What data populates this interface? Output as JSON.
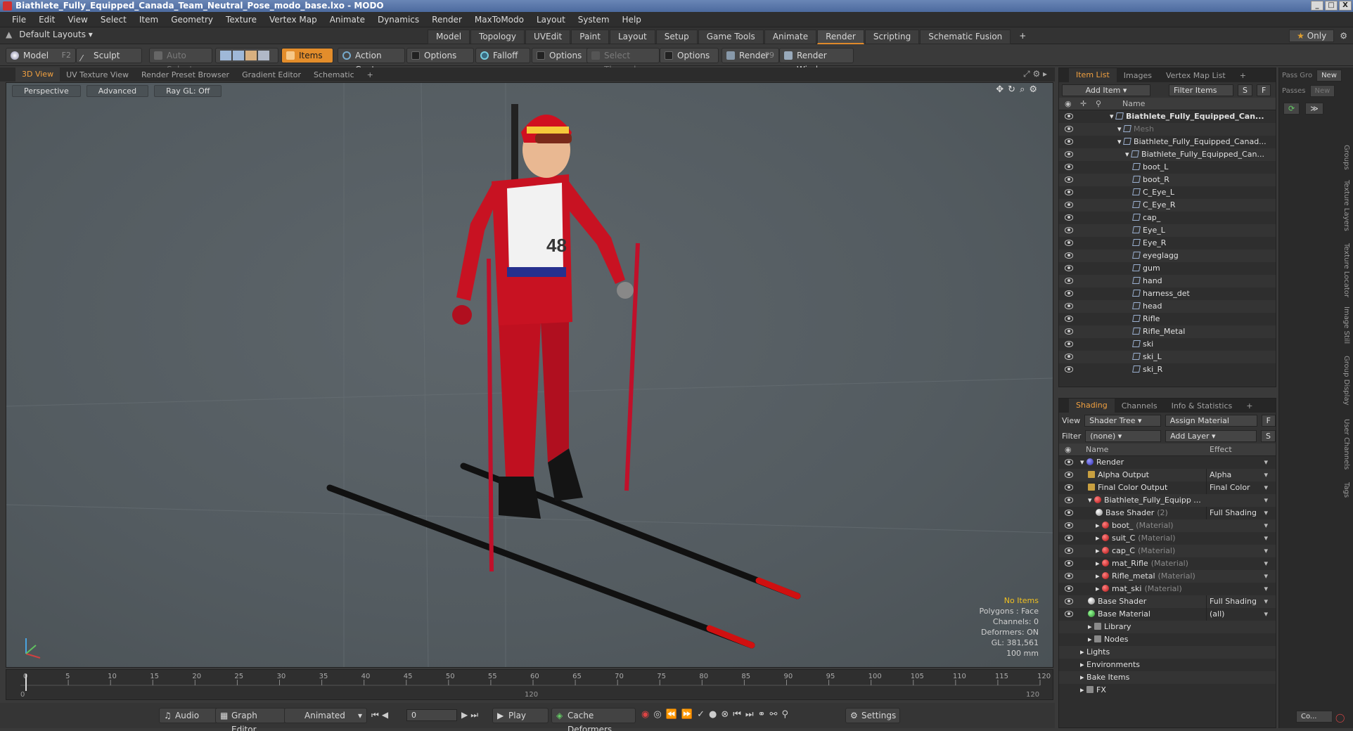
{
  "window": {
    "title": "Biathlete_Fully_Equipped_Canada_Team_Neutral_Pose_modo_base.lxo - MODO",
    "buttons": [
      "_",
      "□",
      "X"
    ]
  },
  "menu": [
    "File",
    "Edit",
    "View",
    "Select",
    "Item",
    "Geometry",
    "Texture",
    "Vertex Map",
    "Animate",
    "Dynamics",
    "Render",
    "MaxToModo",
    "Layout",
    "System",
    "Help"
  ],
  "layoutbar": {
    "layout_select": "Default Layouts",
    "tabs": [
      "Model",
      "Topology",
      "UVEdit",
      "Paint",
      "Layout",
      "Setup",
      "Game Tools",
      "Animate",
      "Render",
      "Scripting",
      "Schematic Fusion"
    ],
    "active_tab": "Render",
    "only_label": "Only"
  },
  "toolbar": {
    "model": "Model",
    "model_key": "F2",
    "sculpt": "Sculpt",
    "auto_select": "Auto Select",
    "items": "Items",
    "action_center": "Action Center",
    "options1": "Options",
    "falloff": "Falloff",
    "options2": "Options",
    "select_through": "Select Through",
    "options3": "Options",
    "render": "Render",
    "render_key": "F9",
    "render_window": "Render Window"
  },
  "viewport_tabs": [
    "3D View",
    "UV Texture View",
    "Render Preset Browser",
    "Gradient Editor",
    "Schematic",
    "+"
  ],
  "viewport": {
    "perspective": "Perspective",
    "advanced": "Advanced",
    "raygl": "Ray GL: Off",
    "info": {
      "no_items": "No Items",
      "polygons": "Polygons : Face",
      "channels": "Channels: 0",
      "deformers": "Deformers: ON",
      "gl": "GL: 381,561",
      "scale": "100 mm"
    },
    "bib_number": "48"
  },
  "timeline": {
    "ticks": [
      "0",
      "5",
      "10",
      "15",
      "20",
      "25",
      "30",
      "35",
      "40",
      "45",
      "50",
      "55",
      "60",
      "65",
      "70",
      "75",
      "80",
      "85",
      "90",
      "95",
      "100",
      "105",
      "110",
      "115",
      "120"
    ],
    "start": "0",
    "mid": "120",
    "end": "120"
  },
  "bottombar": {
    "audio": "Audio",
    "graph_editor": "Graph Editor",
    "animated": "Animated",
    "frame": "0",
    "play": "Play",
    "cache_deformers": "Cache Deformers",
    "settings": "Settings"
  },
  "itemlist": {
    "tabs": [
      "Item List",
      "Images",
      "Vertex Map List",
      "+"
    ],
    "add_item": "Add Item",
    "filter_items": "Filter Items",
    "s": "S",
    "f": "F",
    "col_name": "Name",
    "rows": [
      {
        "name": "Biathlete_Fully_Equipped_Can...",
        "indent": 0,
        "bold": true
      },
      {
        "name": "Mesh",
        "indent": 1,
        "dim": true
      },
      {
        "name": "Biathlete_Fully_Equipped_Canad...",
        "indent": 1
      },
      {
        "name": "Biathlete_Fully_Equipped_Can...",
        "indent": 2
      },
      {
        "name": "boot_L",
        "indent": 3
      },
      {
        "name": "boot_R",
        "indent": 3
      },
      {
        "name": "C_Eye_L",
        "indent": 3
      },
      {
        "name": "C_Eye_R",
        "indent": 3
      },
      {
        "name": "cap_",
        "indent": 3
      },
      {
        "name": "Eye_L",
        "indent": 3
      },
      {
        "name": "Eye_R",
        "indent": 3
      },
      {
        "name": "eyeglagg",
        "indent": 3
      },
      {
        "name": "gum",
        "indent": 3
      },
      {
        "name": "hand",
        "indent": 3
      },
      {
        "name": "harness_det",
        "indent": 3
      },
      {
        "name": "head",
        "indent": 3
      },
      {
        "name": "Rifle",
        "indent": 3
      },
      {
        "name": "Rifle_Metal",
        "indent": 3
      },
      {
        "name": "ski",
        "indent": 3
      },
      {
        "name": "ski_L",
        "indent": 3
      },
      {
        "name": "ski_R",
        "indent": 3
      }
    ]
  },
  "shading": {
    "tabs": [
      "Shading",
      "Channels",
      "Info & Statistics",
      "+"
    ],
    "view_label": "View",
    "view_value": "Shader Tree",
    "assign_material": "Assign Material",
    "filter_label": "Filter",
    "filter_value": "(none)",
    "add_layer": "Add Layer",
    "f": "F",
    "s": "S",
    "col_name": "Name",
    "col_effect": "Effect",
    "rows": [
      {
        "name": "Render",
        "sub": "",
        "effect": "",
        "indent": 0,
        "icon": "blue"
      },
      {
        "name": "Alpha Output",
        "sub": "",
        "effect": "Alpha",
        "indent": 1,
        "icon": "out"
      },
      {
        "name": "Final Color Output",
        "sub": "",
        "effect": "Final Color",
        "indent": 1,
        "icon": "out"
      },
      {
        "name": "Biathlete_Fully_Equipp ...",
        "sub": "",
        "effect": "",
        "indent": 1,
        "icon": "mat"
      },
      {
        "name": "Base Shader",
        "sub": "(2)",
        "effect": "Full Shading",
        "indent": 2,
        "icon": "grey"
      },
      {
        "name": "boot_",
        "sub": "(Material)",
        "effect": "",
        "indent": 2,
        "icon": "mat"
      },
      {
        "name": "suit_C",
        "sub": "(Material)",
        "effect": "",
        "indent": 2,
        "icon": "mat"
      },
      {
        "name": "cap_C",
        "sub": "(Material)",
        "effect": "",
        "indent": 2,
        "icon": "mat"
      },
      {
        "name": "mat_Rifle",
        "sub": "(Material)",
        "effect": "",
        "indent": 2,
        "icon": "mat"
      },
      {
        "name": "Rifle_metal",
        "sub": "(Material)",
        "effect": "",
        "indent": 2,
        "icon": "mat"
      },
      {
        "name": "mat_ski",
        "sub": "(Material)",
        "effect": "",
        "indent": 2,
        "icon": "mat"
      },
      {
        "name": "Base Shader",
        "sub": "",
        "effect": "Full Shading",
        "indent": 1,
        "icon": "grey"
      },
      {
        "name": "Base Material",
        "sub": "",
        "effect": "(all)",
        "indent": 1,
        "icon": "green"
      },
      {
        "name": "Library",
        "sub": "",
        "effect": "",
        "indent": 1,
        "icon": "folder"
      },
      {
        "name": "Nodes",
        "sub": "",
        "effect": "",
        "indent": 1,
        "icon": "folder"
      },
      {
        "name": "Lights",
        "sub": "",
        "effect": "",
        "indent": 0,
        "icon": "none"
      },
      {
        "name": "Environments",
        "sub": "",
        "effect": "",
        "indent": 0,
        "icon": "none"
      },
      {
        "name": "Bake Items",
        "sub": "",
        "effect": "",
        "indent": 0,
        "icon": "none"
      },
      {
        "name": "FX",
        "sub": "",
        "effect": "",
        "indent": 0,
        "icon": "folder"
      }
    ]
  },
  "farright": {
    "pass_group": "Pass Gro",
    "passes": "Passes",
    "new1": "New",
    "new2": "New",
    "vtabs": [
      "Groups",
      "Texture Layers",
      "Texture Locator",
      "Image Still",
      "Group Display",
      "User Channels",
      "Tags"
    ],
    "bottom_btn": "Co..."
  },
  "colors": {
    "accent": "#e08a2a",
    "active_tab_text": "#f0a040",
    "viewport_bg": "#565e63"
  }
}
